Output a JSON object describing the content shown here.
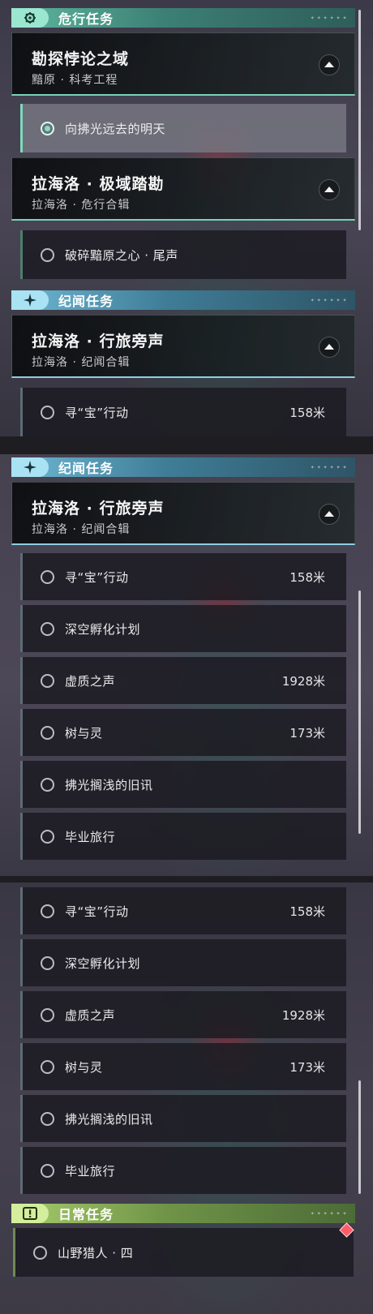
{
  "icons": {
    "danger": "gear-icon",
    "story": "sparkle-icon",
    "daily": "exclamation-icon",
    "collapse": "triangle-up-icon",
    "radio": "radio-icon",
    "marker": "diamond-marker-icon"
  },
  "colors": {
    "danger_accent": "#79d1b6",
    "story_accent": "#8fcde3",
    "daily_accent": "#a7cc6c",
    "marker": "#ff5c6c"
  },
  "panel1": {
    "danger_title": "危行任务",
    "group1": {
      "name": "勘探悖论之域",
      "subtitle": "黯原 · 科考工程"
    },
    "quest_active": "向拂光远去的明天",
    "group2": {
      "name": "拉海洛 · 极域踏勘",
      "subtitle": "拉海洛 · 危行合辑"
    },
    "quest_b": "破碎黯原之心 · 尾声",
    "story_title": "纪闻任务",
    "group3": {
      "name": "拉海洛 · 行旅旁声",
      "subtitle": "拉海洛 · 纪闻合辑"
    },
    "quest_c": {
      "name": "寻“宝”行动",
      "dist": "158米"
    }
  },
  "panel2": {
    "story_title": "纪闻任务",
    "group": {
      "name": "拉海洛 · 行旅旁声",
      "subtitle": "拉海洛 · 纪闻合辑"
    },
    "quests": [
      {
        "name": "寻“宝”行动",
        "dist": "158米"
      },
      {
        "name": "深空孵化计划",
        "dist": ""
      },
      {
        "name": "虚质之声",
        "dist": "1928米"
      },
      {
        "name": "树与灵",
        "dist": "173米"
      },
      {
        "name": "拂光搁浅的旧讯",
        "dist": ""
      },
      {
        "name": "毕业旅行",
        "dist": ""
      }
    ]
  },
  "panel3": {
    "quests": [
      {
        "name": "寻“宝”行动",
        "dist": "158米"
      },
      {
        "name": "深空孵化计划",
        "dist": ""
      },
      {
        "name": "虚质之声",
        "dist": "1928米"
      },
      {
        "name": "树与灵",
        "dist": "173米"
      },
      {
        "name": "拂光搁浅的旧讯",
        "dist": ""
      },
      {
        "name": "毕业旅行",
        "dist": ""
      }
    ],
    "daily_title": "日常任务",
    "daily_quest": "山野猎人 · 四"
  }
}
